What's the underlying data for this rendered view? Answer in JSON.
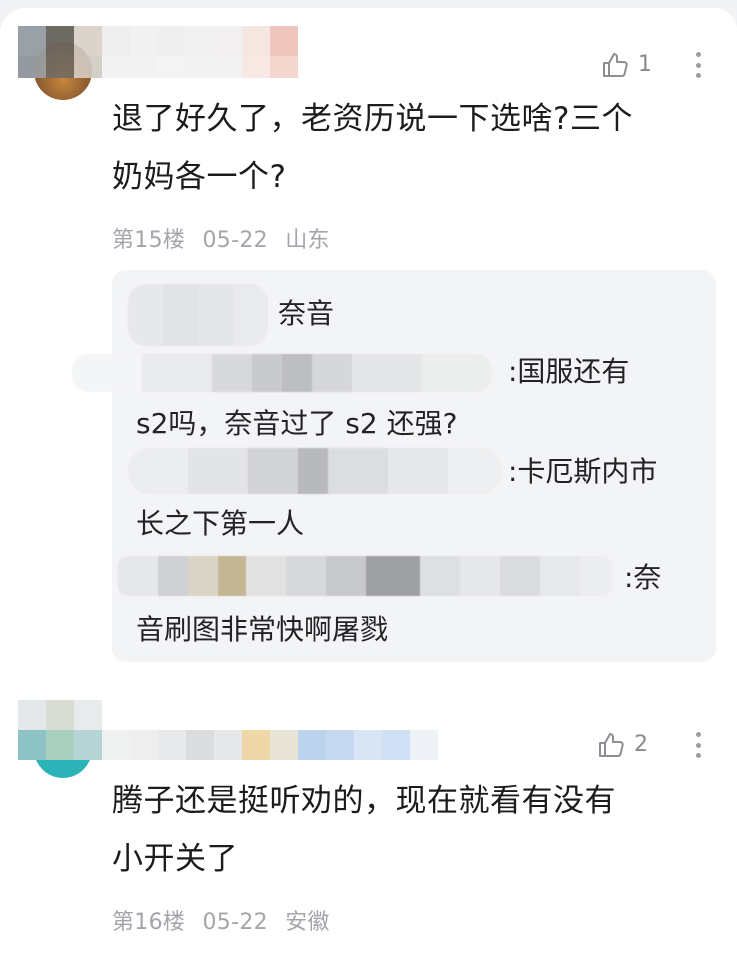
{
  "comments": [
    {
      "likes": "1",
      "text_line1": "退了好久了，老资历说一下选啥?三个",
      "text_line2": "奶妈各一个?",
      "floor": "第15楼",
      "date": "05-22",
      "location": "山东",
      "replies": [
        {
          "line1": "奈音",
          "line2": ""
        },
        {
          "line1": ":国服还有",
          "line2": "s2吗，奈音过了 s2 还强?"
        },
        {
          "line1": ":卡厄斯内市",
          "line2": "长之下第一人"
        },
        {
          "line1": ":奈",
          "line2": "音刷图非常快啊屠戮"
        }
      ]
    },
    {
      "likes": "2",
      "text_line1": "腾子还是挺听劝的，现在就看有没有",
      "text_line2": "小开关了",
      "floor": "第16楼",
      "date": "05-22",
      "location": "安徽"
    }
  ],
  "icons": {
    "like": "thumbs-up-icon",
    "more": "more-vertical-icon"
  },
  "colors": {
    "background": "#f2f3f5",
    "card": "#ffffff",
    "reply_box": "#f3f4f6",
    "meta_text": "#a3a5aa",
    "teal_avatar": "#2bb3b8"
  }
}
